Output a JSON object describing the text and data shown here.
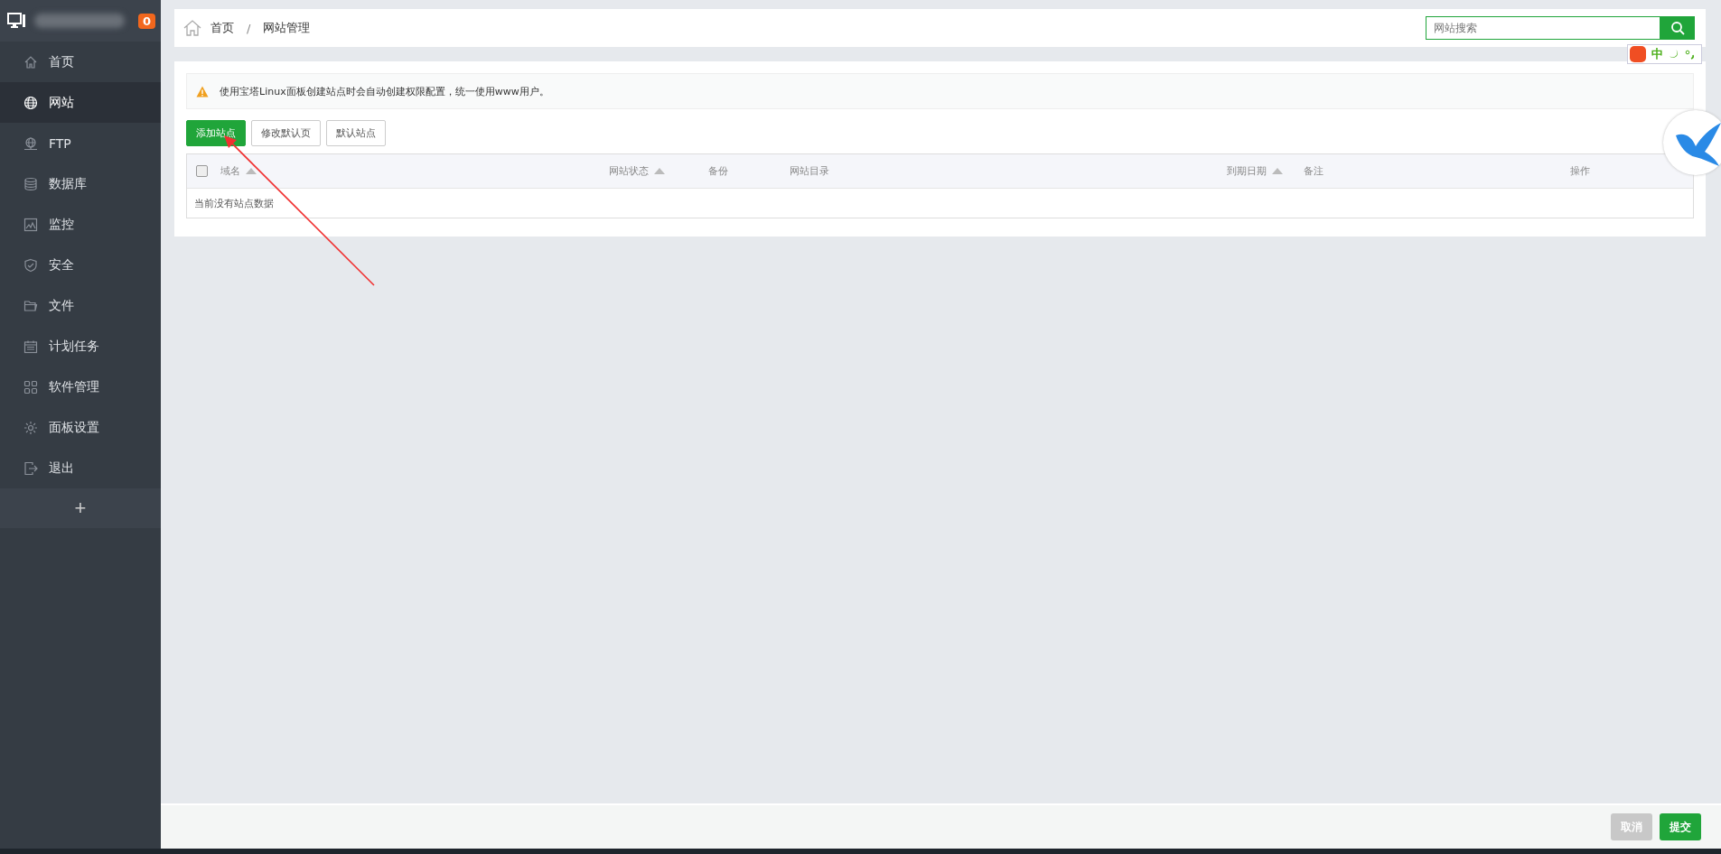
{
  "sidebar": {
    "badge": "0",
    "items": [
      {
        "label": "首页",
        "selected": false
      },
      {
        "label": "网站",
        "selected": true
      },
      {
        "label": "FTP",
        "selected": false
      },
      {
        "label": "数据库",
        "selected": false
      },
      {
        "label": "监控",
        "selected": false
      },
      {
        "label": "安全",
        "selected": false
      },
      {
        "label": "文件",
        "selected": false
      },
      {
        "label": "计划任务",
        "selected": false
      },
      {
        "label": "软件管理",
        "selected": false
      },
      {
        "label": "面板设置",
        "selected": false
      },
      {
        "label": "退出",
        "selected": false
      }
    ],
    "add_button": "+"
  },
  "breadcrumb": [
    "首页",
    "网站管理"
  ],
  "breadcrumb_separator": "/",
  "search": {
    "placeholder": "网站搜索"
  },
  "ime_bar": {
    "mode": "中"
  },
  "notice": "使用宝塔Linux面板创建站点时会自动创建权限配置，统一使用www用户。",
  "buttons": [
    {
      "label": "添加站点",
      "primary": true
    },
    {
      "label": "修改默认页",
      "primary": false
    },
    {
      "label": "默认站点",
      "primary": false
    }
  ],
  "table": {
    "select_all": {
      "checked": false
    },
    "columns": [
      {
        "label": "域名",
        "sortable": true
      },
      {
        "label": "网站状态",
        "sortable": true
      },
      {
        "label": "备份",
        "sortable": false
      },
      {
        "label": "网站目录",
        "sortable": false
      },
      {
        "label": "到期日期",
        "sortable": true
      },
      {
        "label": "备注",
        "sortable": false
      },
      {
        "label": "操作",
        "sortable": false
      }
    ],
    "empty_message": "当前没有站点数据"
  },
  "footer": {
    "buttons": [
      {
        "label": "取消",
        "disabled": true
      },
      {
        "label": "提交",
        "disabled": false
      }
    ]
  }
}
